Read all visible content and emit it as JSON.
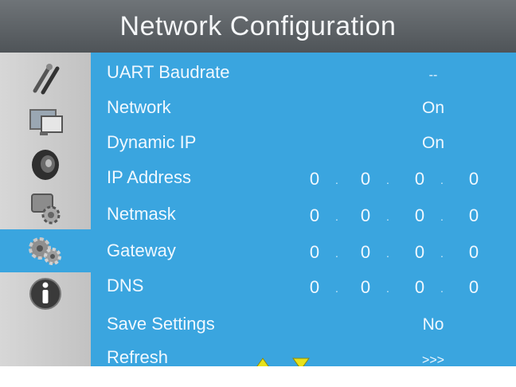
{
  "title": "Network Configuration",
  "sidebar": {
    "items": [
      {
        "icon": "tools-icon",
        "active": false
      },
      {
        "icon": "display-icon",
        "active": false
      },
      {
        "icon": "speaker-icon",
        "active": false
      },
      {
        "icon": "settings-icon",
        "active": false
      },
      {
        "icon": "network-gears-icon",
        "active": true
      },
      {
        "icon": "info-icon",
        "active": false
      }
    ]
  },
  "settings": {
    "uart": {
      "label": "UART Baudrate",
      "value": "--"
    },
    "network": {
      "label": "Network",
      "value": "On"
    },
    "dynamic_ip": {
      "label": "Dynamic IP",
      "value": "On"
    },
    "ip_address": {
      "label": "IP Address",
      "octets": [
        "0",
        "0",
        "0",
        "0"
      ]
    },
    "netmask": {
      "label": "Netmask",
      "octets": [
        "0",
        "0",
        "0",
        "0"
      ]
    },
    "gateway": {
      "label": "Gateway",
      "octets": [
        "0",
        "0",
        "0",
        "0"
      ]
    },
    "dns": {
      "label": "DNS",
      "octets": [
        "0",
        "0",
        "0",
        "0"
      ]
    },
    "save": {
      "label": "Save Settings",
      "value": "No"
    },
    "refresh": {
      "label": "Refresh",
      "value": ">>>"
    }
  },
  "colors": {
    "panel": "#3aa5df",
    "title_bar": "#5a5f63",
    "sidebar": "#cfcfcf",
    "nav_arrow": "#e8e21a"
  }
}
